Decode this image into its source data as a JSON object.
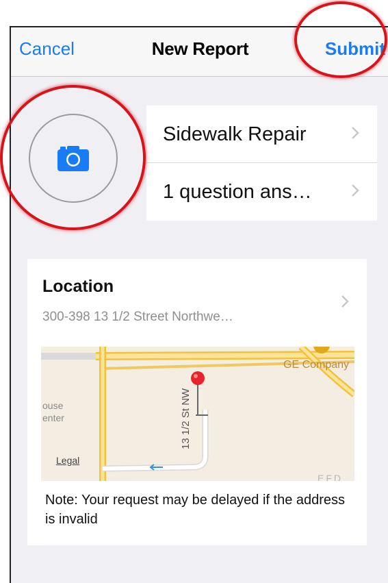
{
  "navbar": {
    "cancel_label": "Cancel",
    "title": "New Report",
    "submit_label": "Submit"
  },
  "photo": {
    "icon": "camera-icon"
  },
  "category": {
    "items": [
      {
        "label": "Sidewalk Repair",
        "icon": "chevron-right-icon"
      },
      {
        "label": "1 question ans…",
        "icon": "chevron-right-icon"
      }
    ]
  },
  "location": {
    "title": "Location",
    "address": "300-398 13 1/2 Street Northwe…",
    "map": {
      "street_label": "13 1/2 St NW",
      "poi_label": "GE Company",
      "left_fragment_1": "ouse",
      "left_fragment_2": "enter",
      "legal_label": "Legal",
      "bottom_fragment": "EFD"
    },
    "note": "Note: Your request may be delayed if the address is invalid"
  },
  "colors": {
    "accent": "#1a7cf5",
    "highlight_ring": "#d8141b",
    "pin": "#e8232b",
    "road": "#f7c94a"
  }
}
